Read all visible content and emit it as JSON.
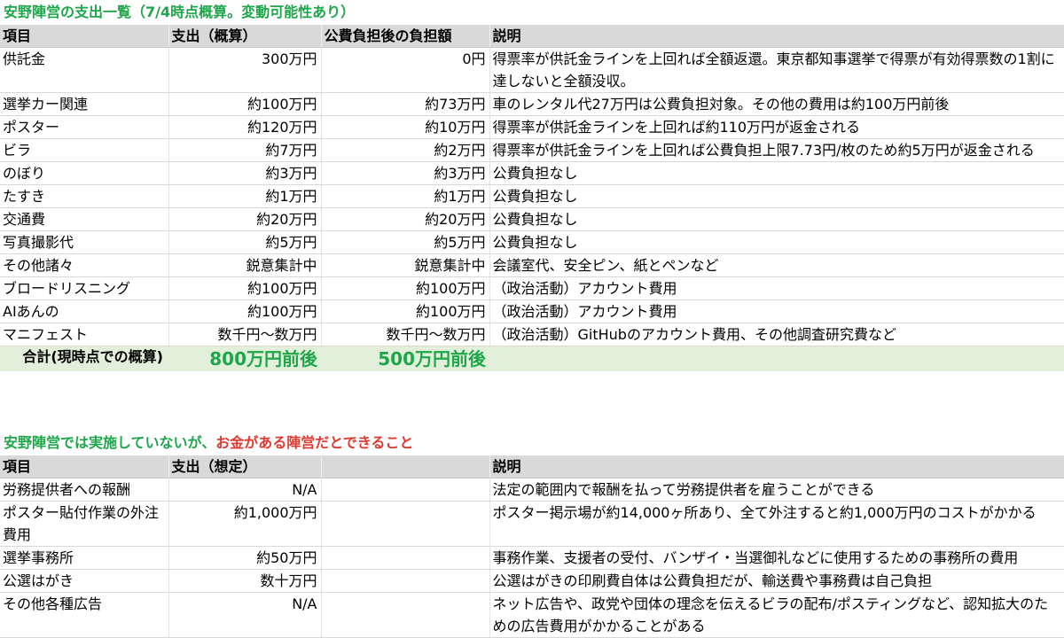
{
  "section1": {
    "title": "安野陣営の支出一覧（7/4時点概算。変動可能性あり）",
    "headers": {
      "item": "項目",
      "cost": "支出（概算）",
      "after_public": "公費負担後の負担額",
      "desc": "説明"
    },
    "rows": [
      {
        "item": "供託金",
        "cost": "300万円",
        "after": "0円",
        "desc": "得票率が供託金ラインを上回れば全額返還。東京都知事選挙で得票が有効得票数の1割に達しないと全額没収。"
      },
      {
        "item": "選挙カー関連",
        "cost": "約100万円",
        "after": "約73万円",
        "desc": "車のレンタル代27万円は公費負担対象。その他の費用は約100万円前後"
      },
      {
        "item": "ポスター",
        "cost": "約120万円",
        "after": "約10万円",
        "desc": "得票率が供託金ラインを上回れば約110万円が返金される"
      },
      {
        "item": "ビラ",
        "cost": "約7万円",
        "after": "約2万円",
        "desc": "得票率が供託金ラインを上回れば公費負担上限7.73円/枚のため約5万円が返金される"
      },
      {
        "item": "のぼり",
        "cost": "約3万円",
        "after": "約3万円",
        "desc": "公費負担なし"
      },
      {
        "item": "たすき",
        "cost": "約1万円",
        "after": "約1万円",
        "desc": "公費負担なし"
      },
      {
        "item": "交通費",
        "cost": "約20万円",
        "after": "約20万円",
        "desc": "公費負担なし"
      },
      {
        "item": "写真撮影代",
        "cost": "約5万円",
        "after": "約5万円",
        "desc": "公費負担なし"
      },
      {
        "item": "その他諸々",
        "cost": "鋭意集計中",
        "after": "鋭意集計中",
        "desc": "会議室代、安全ピン、紙とペンなど"
      },
      {
        "item": "ブロードリスニング",
        "cost": "約100万円",
        "after": "約100万円",
        "desc": "（政治活動）アカウント費用"
      },
      {
        "item": "AIあんの",
        "cost": "約100万円",
        "after": "約100万円",
        "desc": "（政治活動）アカウント費用"
      },
      {
        "item": "マニフェスト",
        "cost": "数千円～数万円",
        "after": "数千円～数万円",
        "desc": "（政治活動）GitHubのアカウント費用、その他調査研究費など"
      }
    ],
    "total": {
      "label": "合計(現時点での概算)",
      "cost": "800万円前後",
      "after": "500万円前後"
    }
  },
  "section2": {
    "title_green": "安野陣営では実施していないが、",
    "title_red": "お金がある陣営だとできること",
    "headers": {
      "item": "項目",
      "cost": "支出（想定）",
      "blank": "",
      "desc": "説明"
    },
    "rows": [
      {
        "item": "労務提供者への報酬",
        "cost": "N/A",
        "desc": "法定の範囲内で報酬を払って労務提供者を雇うことができる"
      },
      {
        "item": "ポスター貼付作業の外注費用",
        "cost": "約1,000万円",
        "desc": "ポスター掲示場が約14,000ヶ所あり、全て外注すると約1,000万円のコストがかかる"
      },
      {
        "item": "選挙事務所",
        "cost": "約50万円",
        "desc": "事務作業、支援者の受付、バンザイ・当選御礼などに使用するための事務所の費用"
      },
      {
        "item": "公選はがき",
        "cost": "数十万円",
        "desc": "公選はがきの印刷費自体は公費負担だが、輸送費や事務費は自己負担"
      },
      {
        "item": "その他各種広告",
        "cost": "N/A",
        "desc": "ネット広告や、政党や団体の理念を伝えるビラの配布/ポスティングなど、認知拡大のための広告費用がかかることがある"
      }
    ]
  },
  "colors": {
    "header_bg": "#d9d9d9",
    "total_bg": "#e2efda",
    "accent_green": "#1ea64a",
    "accent_red": "#e03a2f"
  }
}
